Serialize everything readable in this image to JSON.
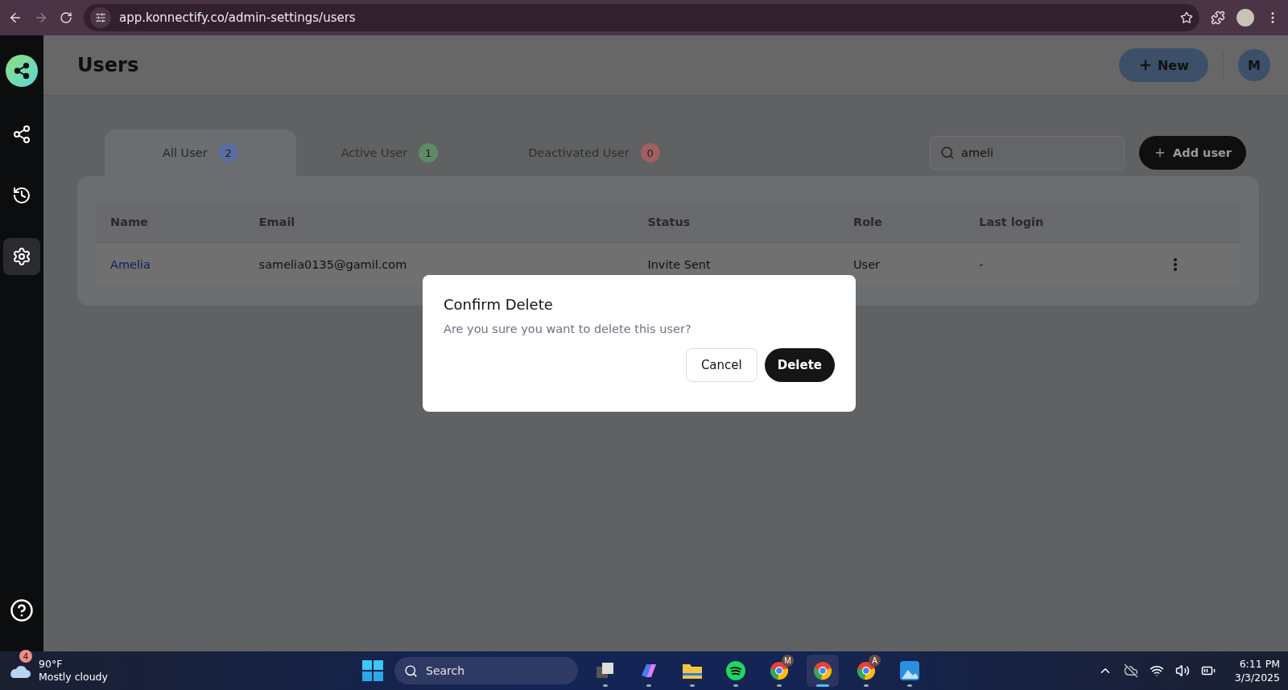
{
  "browser": {
    "url": "app.konnectify.co/admin-settings/users"
  },
  "sidebar": {
    "items": [
      {
        "kind": "share",
        "selected": false
      },
      {
        "kind": "history",
        "selected": false
      },
      {
        "kind": "settings",
        "selected": true
      }
    ]
  },
  "header": {
    "title": "Users",
    "new_button": "New",
    "avatar": "M"
  },
  "tabs": [
    {
      "label": "All User",
      "count": "2",
      "color": "#5b6ea0",
      "selected": true
    },
    {
      "label": "Active User",
      "count": "1",
      "color": "#5f8a66",
      "selected": false
    },
    {
      "label": "Deactivated User",
      "count": "0",
      "color": "#a06060",
      "selected": false
    }
  ],
  "search": {
    "value": "ameli"
  },
  "add_button": "Add user",
  "table": {
    "columns": [
      "Name",
      "Email",
      "Status",
      "Role",
      "Last login"
    ],
    "rows": [
      {
        "name": "Amelia",
        "email": "samelia0135@gamil.com",
        "status": "Invite Sent",
        "role": "User",
        "last_login": "-"
      }
    ]
  },
  "dialog": {
    "title": "Confirm Delete",
    "message": "Are you sure you want to delete this user?",
    "cancel": "Cancel",
    "confirm": "Delete"
  },
  "taskbar": {
    "weather": {
      "badge": "4",
      "temp": "90°F",
      "condition": "Mostly cloudy"
    },
    "search": {
      "placeholder": "Search"
    },
    "apps": [
      {
        "kind": "taskview",
        "active": false
      },
      {
        "kind": "copilot",
        "active": false
      },
      {
        "kind": "files",
        "active": false
      },
      {
        "kind": "spotify",
        "active": false
      },
      {
        "kind": "chrome",
        "badge": "M",
        "active": false
      },
      {
        "kind": "chrome",
        "active": true
      },
      {
        "kind": "chrome",
        "badge": "A",
        "active": false
      },
      {
        "kind": "photos",
        "active": false
      }
    ],
    "time": "6:11 PM",
    "date": "3/3/2025"
  }
}
